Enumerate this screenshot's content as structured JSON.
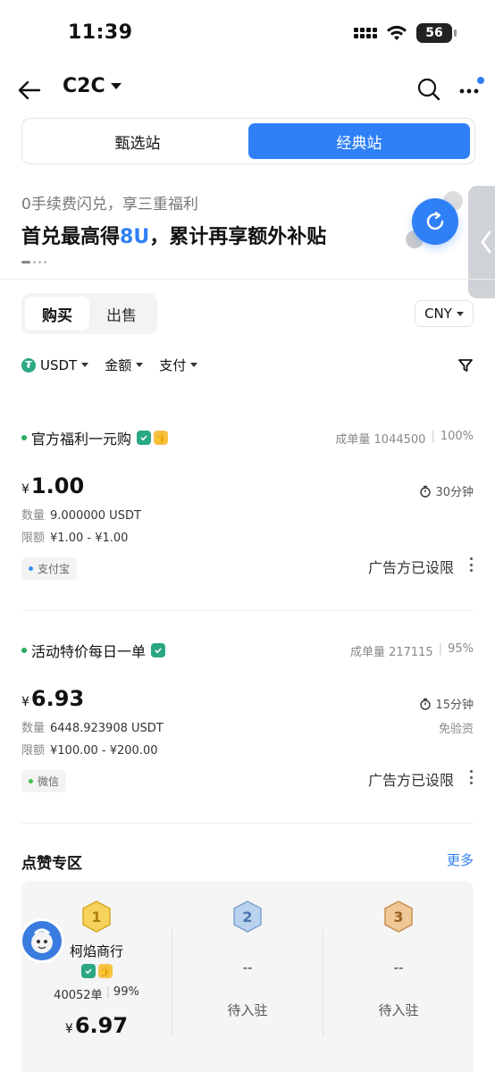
{
  "status": {
    "time": "11:39",
    "battery": "56"
  },
  "nav": {
    "title": "C2C"
  },
  "segment": {
    "tabs": [
      {
        "label": "甄选站"
      },
      {
        "label": "经典站"
      }
    ]
  },
  "promo": {
    "subtitle": "0手续费闪兑，享三重福利",
    "title_prefix": "首兑最高得",
    "title_highlight": "8U",
    "title_suffix": "，累计再享额外补贴"
  },
  "trade": {
    "buy_label": "购买",
    "sell_label": "出售",
    "currency": "CNY"
  },
  "filters": {
    "asset": "USDT",
    "amount": "金额",
    "payment": "支付"
  },
  "listings": [
    {
      "merchant": "官方福利一元购",
      "orders": "成单量 1044500",
      "completion": "100%",
      "yen": "¥",
      "price": "1.00",
      "time": "30分钟",
      "qty_label": "数量",
      "qty": "9.000000 USDT",
      "limit_label": "限额",
      "limit": "¥1.00 - ¥1.00",
      "payment": "支付宝",
      "payment_color": "#3b8ef5",
      "restricted": "广告方已设限"
    },
    {
      "merchant": "活动特价每日一单",
      "orders": "成单量 217115",
      "completion": "95%",
      "yen": "¥",
      "price": "6.93",
      "time": "15分钟",
      "waived": "免验资",
      "qty_label": "数量",
      "qty": "6448.923908 USDT",
      "limit_label": "限额",
      "limit": "¥100.00 - ¥200.00",
      "payment": "微信",
      "payment_color": "#3fbf4a",
      "restricted": "广告方已设限"
    }
  ],
  "like_zone": {
    "title": "点赞专区",
    "more": "更多",
    "ranks": [
      {
        "name": "柯焰商行",
        "orders": "40052单",
        "completion": "99%",
        "yen": "¥",
        "price": "6.97"
      },
      {
        "name": "--",
        "status": "待入驻"
      },
      {
        "name": "--",
        "status": "待入驻"
      }
    ]
  },
  "colors": {
    "accent": "#2f80f7",
    "green": "#2aa883",
    "gold": "#f5c242"
  }
}
